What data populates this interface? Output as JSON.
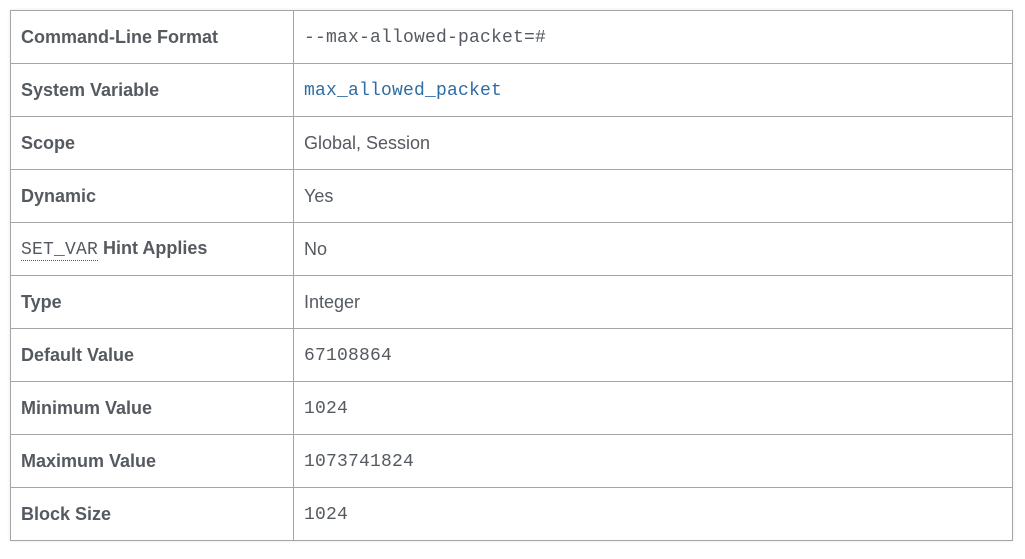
{
  "rows": {
    "command_line_format": {
      "label": "Command-Line Format",
      "value": "--max-allowed-packet=#"
    },
    "system_variable": {
      "label": "System Variable",
      "value": "max_allowed_packet"
    },
    "scope": {
      "label": "Scope",
      "value": "Global, Session"
    },
    "dynamic": {
      "label": "Dynamic",
      "value": "Yes"
    },
    "set_var_hint": {
      "label_code": "SET_VAR",
      "label_rest": " Hint Applies",
      "value": "No"
    },
    "type": {
      "label": "Type",
      "value": "Integer"
    },
    "default_value": {
      "label": "Default Value",
      "value": "67108864"
    },
    "minimum_value": {
      "label": "Minimum Value",
      "value": "1024"
    },
    "maximum_value": {
      "label": "Maximum Value",
      "value": "1073741824"
    },
    "block_size": {
      "label": "Block Size",
      "value": "1024"
    }
  }
}
